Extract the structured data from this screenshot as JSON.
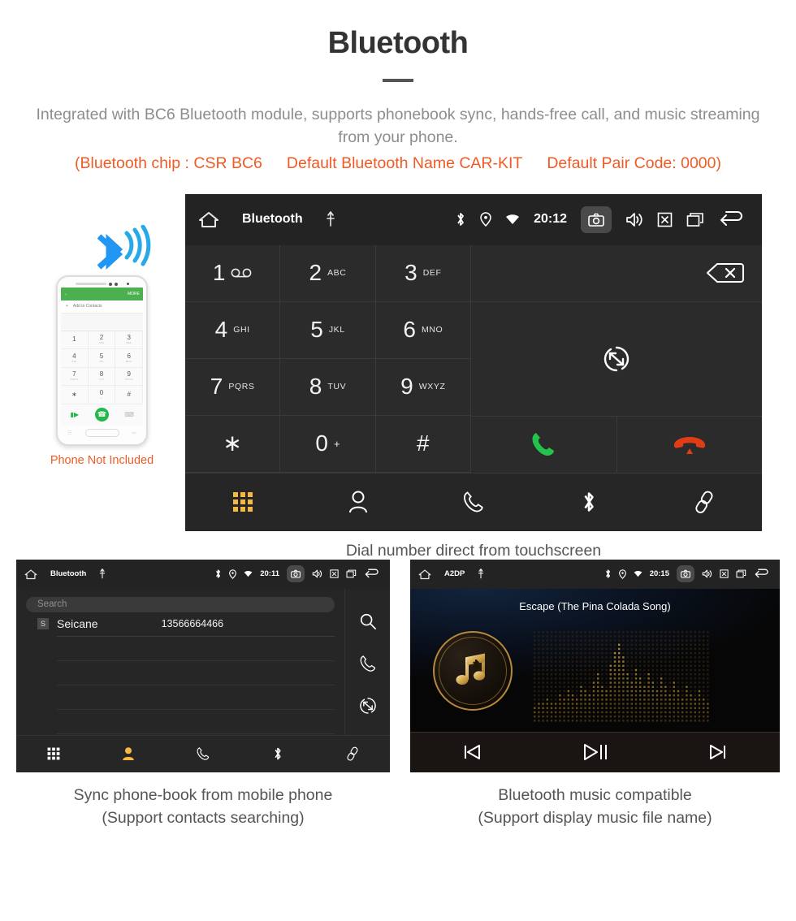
{
  "header": {
    "title": "Bluetooth",
    "intro": "Integrated with BC6 Bluetooth module, supports phonebook sync, hands-free call, and music streaming from your phone.",
    "specs": [
      "(Bluetooth chip : CSR BC6",
      "Default Bluetooth Name CAR-KIT",
      "Default Pair Code: 0000)"
    ]
  },
  "phone_mock": {
    "appbar_back": "←",
    "appbar_more": "MORE",
    "add_contact": "Add to Contacts",
    "keys": [
      {
        "num": "1",
        "sub": ""
      },
      {
        "num": "2",
        "sub": "ABC"
      },
      {
        "num": "3",
        "sub": "DEF"
      },
      {
        "num": "4",
        "sub": "GHI"
      },
      {
        "num": "5",
        "sub": "JKL"
      },
      {
        "num": "6",
        "sub": "MNO"
      },
      {
        "num": "7",
        "sub": "PQRS"
      },
      {
        "num": "8",
        "sub": "TUV"
      },
      {
        "num": "9",
        "sub": "WXYZ"
      },
      {
        "num": "∗",
        "sub": ""
      },
      {
        "num": "0",
        "sub": "+"
      },
      {
        "num": "#",
        "sub": ""
      }
    ],
    "caption": "Phone Not Included",
    "caption_color": "#f15a24"
  },
  "dialer": {
    "statusbar": {
      "title": "Bluetooth",
      "time": "20:12",
      "icons_left": [
        "home-icon",
        "usb-icon"
      ],
      "icons_right": [
        "bluetooth-icon",
        "location-icon",
        "wifi-icon",
        "camera-icon",
        "volume-icon",
        "close-icon",
        "recents-icon",
        "back-icon"
      ]
    },
    "keys": [
      {
        "num": "1",
        "sub": "",
        "voicemail": true
      },
      {
        "num": "2",
        "sub": "ABC"
      },
      {
        "num": "3",
        "sub": "DEF"
      },
      {
        "num": "4",
        "sub": "GHI"
      },
      {
        "num": "5",
        "sub": "JKL"
      },
      {
        "num": "6",
        "sub": "MNO"
      },
      {
        "num": "7",
        "sub": "PQRS"
      },
      {
        "num": "8",
        "sub": "TUV"
      },
      {
        "num": "9",
        "sub": "WXYZ"
      },
      {
        "num": "∗",
        "sub": ""
      },
      {
        "num": "0",
        "sub": "+"
      },
      {
        "num": "#",
        "sub": ""
      }
    ],
    "number_value": "",
    "actions": {
      "backspace": "backspace-icon",
      "transfer": "transfer-audio-icon",
      "call": "call-icon",
      "hangup": "hangup-icon",
      "call_color": "#23c24a",
      "hangup_color": "#e03c16"
    },
    "tabs": [
      {
        "name": "keypad",
        "icon": "keypad-icon",
        "active": true
      },
      {
        "name": "contacts",
        "icon": "contact-icon",
        "active": false
      },
      {
        "name": "history",
        "icon": "call-history-icon",
        "active": false
      },
      {
        "name": "bluetooth",
        "icon": "bluetooth-icon",
        "active": false
      },
      {
        "name": "pair",
        "icon": "link-icon",
        "active": false
      }
    ],
    "accent": "#f5b942",
    "caption": "Dial number direct from touchscreen"
  },
  "contacts": {
    "statusbar": {
      "title": "Bluetooth",
      "time": "20:11"
    },
    "search_placeholder": "Search",
    "rows": [
      {
        "badge": "S",
        "name": "Seicane",
        "number": "13566664466"
      }
    ],
    "empty_rows": 4,
    "rail": [
      "search-icon",
      "call-icon",
      "sync-icon"
    ],
    "tabs": [
      {
        "name": "keypad",
        "icon": "keypad-icon",
        "active": false
      },
      {
        "name": "contacts",
        "icon": "contact-icon",
        "active": true
      },
      {
        "name": "history",
        "icon": "call-history-icon",
        "active": false
      },
      {
        "name": "bluetooth",
        "icon": "bluetooth-icon",
        "active": false
      },
      {
        "name": "pair",
        "icon": "link-icon",
        "active": false
      }
    ],
    "caption_line1": "Sync phone-book from mobile phone",
    "caption_line2": "(Support contacts searching)"
  },
  "music": {
    "statusbar": {
      "title": "A2DP",
      "time": "20:15"
    },
    "song_title": "Escape (The Pina Colada Song)",
    "album_icon": "music-note-bluetooth-icon",
    "transport": [
      {
        "name": "previous",
        "icon": "previous-icon"
      },
      {
        "name": "play-pause",
        "icon": "play-pause-icon"
      },
      {
        "name": "next",
        "icon": "next-icon"
      }
    ],
    "accent": "#c8962e",
    "caption_line1": "Bluetooth music compatible",
    "caption_line2": "(Support display music file name)"
  }
}
